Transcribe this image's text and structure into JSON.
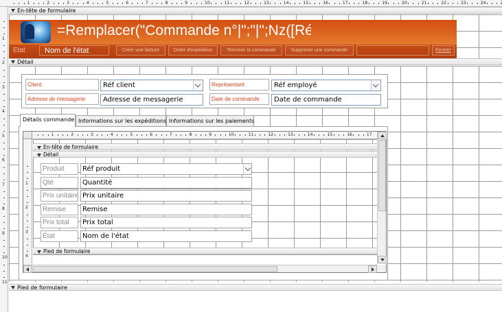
{
  "sections": {
    "form_header": "En-tête de formulaire",
    "detail": "Détail",
    "form_footer": "Pied de formulaire"
  },
  "header": {
    "title_expr": "=Remplacer(\"Commande n°|\";\"|\";Nz([Réf comi",
    "etat_label": "Etat",
    "etat_field": "Nom de l'état",
    "buttons": [
      "Créer une facture",
      "Ordre d'expédition",
      "Terminer la commande",
      "Supprimer une commande",
      "Fermer"
    ]
  },
  "detail": {
    "client_label": "Client",
    "client_field": "Réf client",
    "rep_label": "Représentant",
    "rep_field": "Réf employé",
    "address_label": "Adresse de messagerie",
    "address_field": "Adresse de messagerie",
    "date_label": "Date de commande",
    "date_field": "Date de commande"
  },
  "tabs": [
    "Détails commande",
    "Informations sur les expéditions",
    "Informations sur les paiements"
  ],
  "subform": {
    "header_section": "En-tête de formulaire",
    "detail_section": "Détail",
    "footer_section": "Pied de formulaire",
    "rows": [
      {
        "label": "Produit",
        "field": "Réf produit"
      },
      {
        "label": "Qté",
        "field": "Quantité"
      },
      {
        "label": "Prix unitaire",
        "field": "Prix unitaire"
      },
      {
        "label": "Remise",
        "field": "Remise"
      },
      {
        "label": "Prix total",
        "field": "Prix total"
      },
      {
        "label": "État",
        "field": "Nom de l'état"
      }
    ]
  },
  "ruler": {
    "top": [
      "1",
      "2",
      "3",
      "4",
      "5",
      "6",
      "7",
      "8",
      "9",
      "10",
      "11",
      "12",
      "13",
      "14",
      "15",
      "16",
      "17",
      "18",
      "19",
      "20",
      "21",
      "22",
      "23",
      "24",
      "25"
    ],
    "left": [
      "1",
      "2",
      "3",
      "4",
      "5",
      "6",
      "7",
      "8",
      "9",
      "10",
      "11"
    ],
    "sub_top": [
      "1",
      "2",
      "3",
      "4",
      "5",
      "6",
      "7",
      "8",
      "9",
      "10",
      "11",
      "12",
      "13",
      "14",
      "15",
      "16",
      "17"
    ],
    "sub_left": [
      "1",
      "2",
      "3",
      "4"
    ]
  },
  "colors": {
    "header_orange": "#d95218",
    "label_red": "#e0411a"
  }
}
